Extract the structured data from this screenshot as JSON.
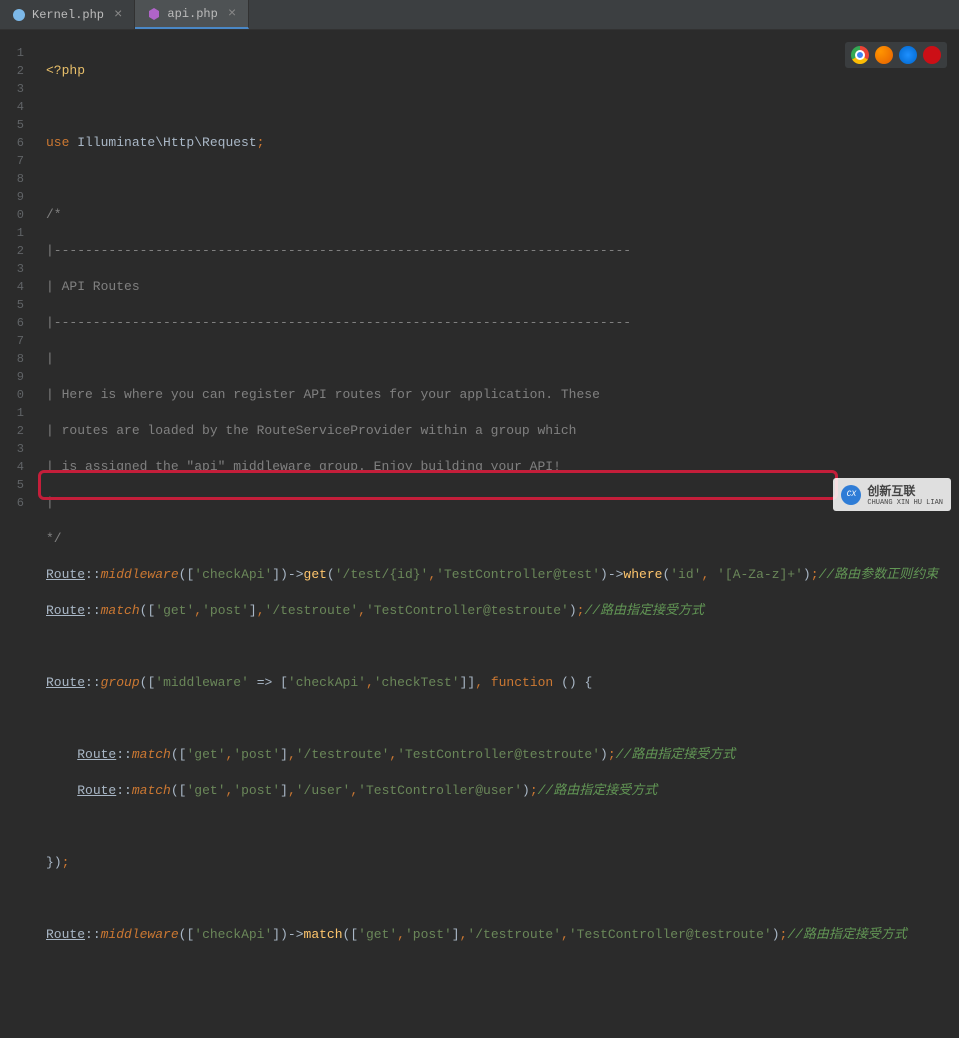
{
  "tabs": [
    {
      "label": "Kernel.php",
      "icon_color": "#7cb8e8"
    },
    {
      "label": "api.php",
      "icon_color": "#b064c9"
    }
  ],
  "gutter_start": 1,
  "line1": {
    "tag": "<?php"
  },
  "line3": {
    "use": "use ",
    "ns": "Illuminate\\Http\\Request",
    "semi": ";"
  },
  "comments": {
    "l5": "/*",
    "l6": "|--------------------------------------------------------------------------",
    "l7": "| API Routes",
    "l8": "|--------------------------------------------------------------------------",
    "l9": "|",
    "l10": "| Here is where you can register API routes for your application. These",
    "l11": "| routes are loaded by the RouteServiceProvider within a group which",
    "l12": "| is assigned the \"api\" middleware group. Enjoy building your API!",
    "l13": "|",
    "l14": "*/"
  },
  "code": {
    "route": "Route",
    "dblcolon": "::",
    "middleware": "middleware",
    "match": "match",
    "get": "get",
    "where": "where",
    "group": "group",
    "function": "function",
    "lbr": "(",
    "rbr": ")",
    "lsq": "[",
    "rsq": "]",
    "lcb": "{",
    "rcb": "}",
    "comma": ",",
    "semi": ";",
    "arrow": "->",
    "fatArrow": " => ",
    "str_checkApi": "'checkApi'",
    "str_checkTest": "'checkTest'",
    "str_test_id": "'/test/{id}'",
    "str_tc_test": "'TestController@test'",
    "str_id": "'id'",
    "str_regex": "'[A-Za-z]+'",
    "str_get": "'get'",
    "str_post": "'post'",
    "str_testroute": "'/testroute'",
    "str_tc_testroute": "'TestController@testroute'",
    "str_user": "'/user'",
    "str_tc_user": "'TestController@user'",
    "str_middleware": "'middleware'",
    "cmt_regex": "//路由参数正则约束",
    "cmt_method": "//路由指定接受方式"
  },
  "line_numbers": [
    "1",
    "2",
    "3",
    "4",
    "5",
    "6",
    "7",
    "8",
    "9",
    "0",
    "1",
    "2",
    "3",
    "4",
    "5",
    "6",
    "7",
    "8",
    "9",
    "0",
    "1",
    "2",
    "3",
    "4",
    "5",
    "6"
  ],
  "watermark": {
    "main": "创新互联",
    "sub": "CHUANG XIN HU LIAN"
  },
  "browser_icons": [
    "chrome",
    "firefox",
    "safari",
    "opera"
  ]
}
